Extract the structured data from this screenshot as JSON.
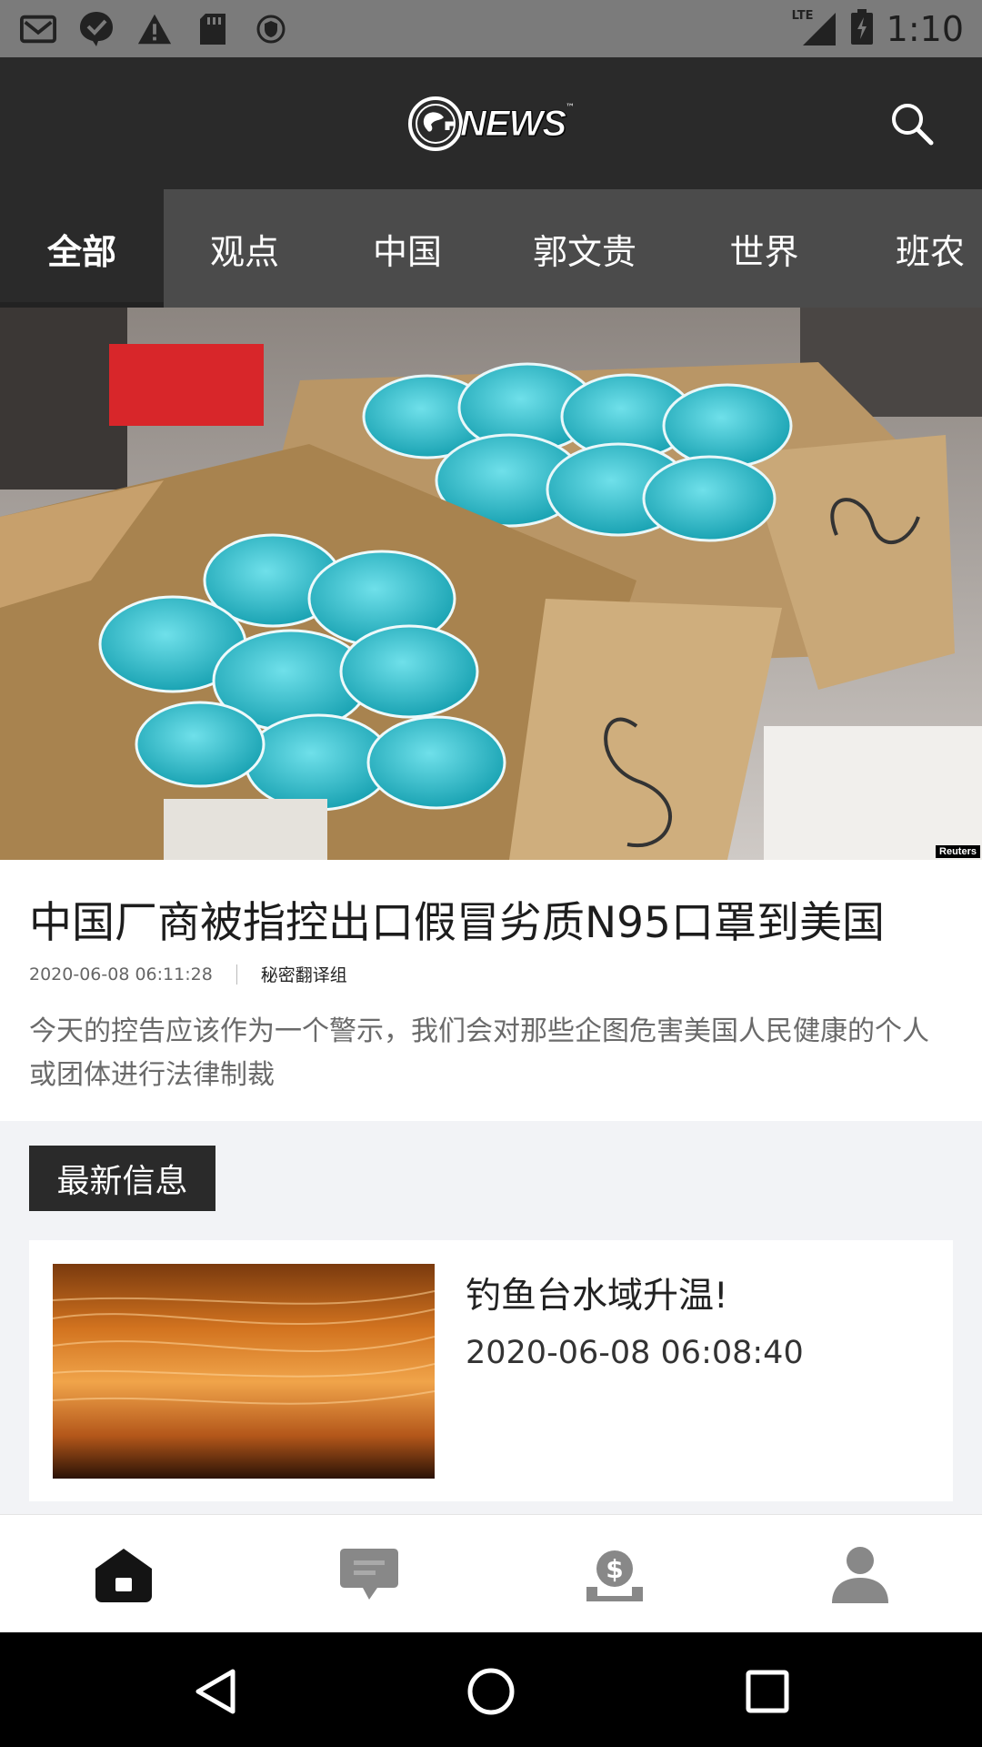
{
  "status_bar": {
    "time": "1:10",
    "network": "LTE",
    "icons": [
      "gmail-icon",
      "check-badge-icon",
      "warning-icon",
      "sd-card-icon",
      "vpn-shield-icon",
      "signal-icon",
      "battery-charging-icon"
    ]
  },
  "header": {
    "logo_letter": "G",
    "logo_text": "NEWS",
    "logo_mark": "™"
  },
  "tabs": [
    {
      "label": "全部",
      "active": true
    },
    {
      "label": "观点",
      "active": false
    },
    {
      "label": "中国",
      "active": false
    },
    {
      "label": "郭文贵",
      "active": false
    },
    {
      "label": "世界",
      "active": false
    },
    {
      "label": "班农",
      "active": false
    }
  ],
  "hero": {
    "credit": "Reuters"
  },
  "article": {
    "headline": "中国厂商被指控出口假冒劣质N95口罩到美国",
    "date": "2020-06-08 06:11:28",
    "author": "秘密翻译组",
    "summary": "今天的控告应该作为一个警示，我们会对那些企图危害美国人民健康的个人或团体进行法律制裁"
  },
  "latest": {
    "section_title": "最新信息",
    "items": [
      {
        "title": "钓鱼台水域升温!",
        "date": "2020-06-08 06:08:40"
      }
    ]
  },
  "bottom_nav": [
    "home-icon",
    "chat-icon",
    "donate-icon",
    "profile-icon"
  ],
  "colors": {
    "header_bg": "#2a2a2a",
    "tab_bar_bg": "#4b4b4b",
    "status_bar_bg": "#7b7b7b",
    "page_bg": "#f2f3f6"
  }
}
